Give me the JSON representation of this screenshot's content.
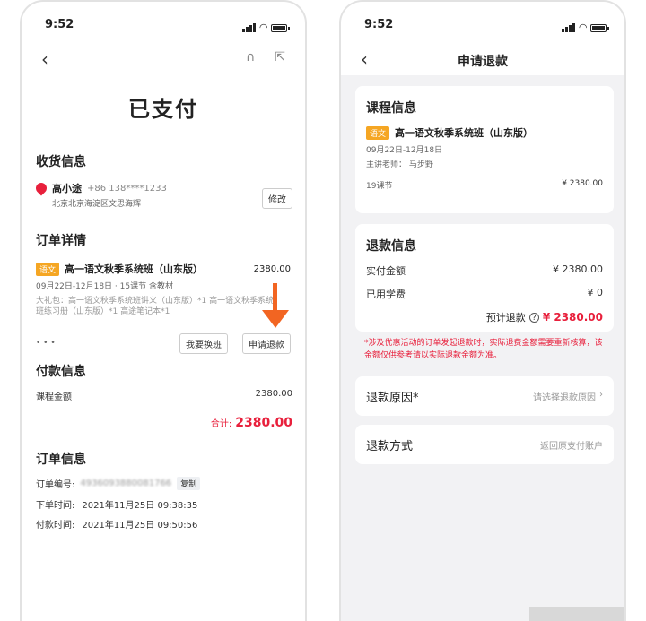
{
  "left": {
    "status_time": "9:52",
    "title": "已支付",
    "shipping": {
      "section_title": "收货信息",
      "name": "高小途",
      "phone": "+86 138****1233",
      "address": "北京北京海淀区文思海辉",
      "edit_label": "修改"
    },
    "order_detail": {
      "section_title": "订单详情",
      "tag": "语文",
      "course": "高一语文秋季系统班（山东版）",
      "price": "2380.00",
      "meta": "09月22日-12月18日 · 15课节  含教材",
      "gift": "大礼包：高一语文秋季系统班讲义（山东版）*1  高一语文秋季系统班练习册（山东版）*1  高途笔记本*1",
      "more": "• • •",
      "change_label": "我要换班",
      "refund_label": "申请退款"
    },
    "payment": {
      "section_title": "付款信息",
      "amount_label": "课程金额",
      "amount": "2380.00",
      "total_label": "合计:",
      "total": "2380.00"
    },
    "order_info": {
      "section_title": "订单信息",
      "no_label": "订单编号:",
      "no_value": "4936093880081766",
      "copy_label": "复制",
      "order_time_label": "下单时间:",
      "order_time": "2021年11月25日 09:38:35",
      "pay_time_label": "付款时间:",
      "pay_time": "2021年11月25日 09:50:56"
    }
  },
  "right": {
    "status_time": "9:52",
    "title": "申请退款",
    "course_info": {
      "section_title": "课程信息",
      "tag": "语文",
      "course": "高一语文秋季系统班（山东版）",
      "dates": "09月22日-12月18日",
      "teacher": "主讲老师：  马步野",
      "lessons": "19课节",
      "price": "¥ 2380.00"
    },
    "refund_info": {
      "section_title": "退款信息",
      "paid_label": "实付金额",
      "paid": "¥ 2380.00",
      "used_label": "已用学费",
      "used": "¥ 0",
      "est_label": "预计退款",
      "est": "¥ 2380.00"
    },
    "notice": "*涉及优惠活动的订单发起退款时，实际退费金额需要重新核算，该金额仅供参考请以实际退款金额为准。",
    "reason": {
      "label": "退款原因*",
      "placeholder": "请选择退款原因"
    },
    "method": {
      "label": "退款方式",
      "value": "返回原支付账户"
    }
  }
}
